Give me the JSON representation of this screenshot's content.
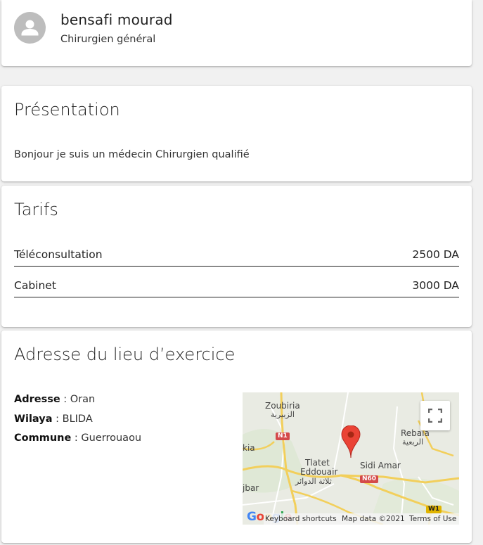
{
  "profile": {
    "name": "bensafi mourad",
    "specialty": "Chirurgien général",
    "avatar_icon": "person-icon"
  },
  "presentation": {
    "title": "Présentation",
    "text": "Bonjour je suis un médecin Chirurgien qualifié"
  },
  "tarifs": {
    "title": "Tarifs",
    "items": [
      {
        "label": "Téléconsultation",
        "price": "2500 DA"
      },
      {
        "label": "Cabinet",
        "price": "3000 DA"
      }
    ]
  },
  "adresse": {
    "title": "Adresse du lieu d’exercice",
    "adresse_label": "Adresse",
    "adresse_value": "Oran",
    "wilaya_label": "Wilaya",
    "wilaya_value": "BLIDA",
    "commune_label": "Commune",
    "commune_value": "Guerrouaou",
    "separator": " : "
  },
  "map": {
    "labels": {
      "zoubiria": "Zoubiria",
      "zoubiria_ar": "الزبيرية",
      "rebaia": "Rebaia",
      "rebaia_ar": "الربعية",
      "tlatet": "Tlatet",
      "eddouair": "Eddouair",
      "tlatet_ar": "ثلاثة الدوائر",
      "sidi_amar": "Sidi Amar",
      "kia": "kia",
      "jbar": "jbar"
    },
    "roads": {
      "n1": "N1",
      "n60": "N60",
      "w1": "W1"
    },
    "google_logo": "Google",
    "keyboard_shortcuts": "Keyboard shortcuts",
    "map_data": "Map data ©2021",
    "terms": "Terms of Use",
    "fullscreen_icon": "fullscreen-icon",
    "pin_icon": "map-pin-icon",
    "colors": {
      "pin": "#ea4335",
      "road_major": "#f5d96b",
      "road_shield": "#d44a4a",
      "road_shield_w": "#e0b400"
    }
  }
}
